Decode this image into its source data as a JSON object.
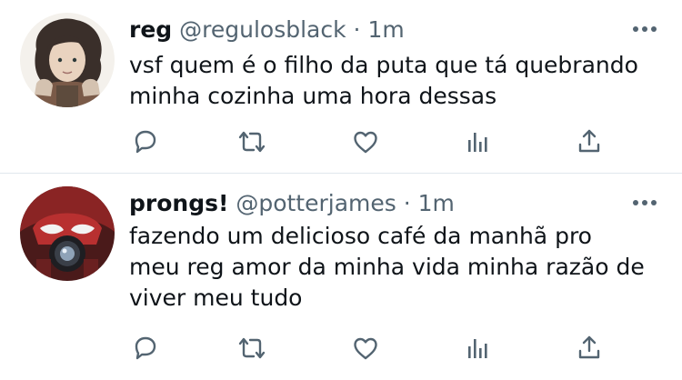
{
  "tweets": [
    {
      "display_name": "reg",
      "handle": "@regulosblack",
      "separator": "·",
      "time": "1m",
      "text_lines": [
        "vsf quem é o filho da puta que tá quebrando",
        "minha cozinha uma hora dessas"
      ]
    },
    {
      "display_name": "prongs!",
      "handle": "@potterjames",
      "separator": "·",
      "time": "1m",
      "text_lines": [
        "fazendo um delicioso café da manhã pro",
        "meu reg amor da minha vida minha razão de",
        "viver meu tudo"
      ]
    }
  ],
  "icons": {
    "more": "more-dots-icon",
    "reply": "reply-bubble-icon",
    "retweet": "retweet-arrows-icon",
    "like": "heart-icon",
    "analytics": "analytics-bars-icon",
    "share": "share-upload-icon"
  },
  "colors": {
    "text": "#0f1419",
    "secondary": "#536471",
    "divider": "#e1e8ed"
  }
}
